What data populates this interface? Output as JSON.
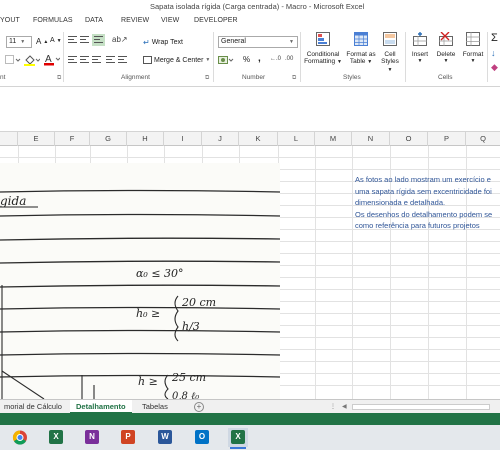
{
  "window": {
    "title": "Sapata isolada rígida (Carga centrada) - Macro - Microsoft Excel"
  },
  "ribbon_tabs": [
    "YOUT",
    "FORMULAS",
    "DATA",
    "REVIEW",
    "VIEW",
    "DEVELOPER"
  ],
  "ribbon": {
    "font_size": "11",
    "wrap_text": "Wrap Text",
    "merge_center": "Merge & Center",
    "number_format": "General",
    "percent": "%",
    "comma": ",",
    "conditional_formatting": [
      "Conditional",
      "Formatting"
    ],
    "format_as_table": [
      "Format as",
      "Table"
    ],
    "cell_styles": [
      "Cell",
      "Styles"
    ],
    "insert": "Insert",
    "delete": "Delete",
    "format": "Format",
    "groups": {
      "font_tail": "nt",
      "alignment": "Alignment",
      "number": "Number",
      "styles": "Styles",
      "cells": "Cells"
    }
  },
  "columns": [
    "E",
    "F",
    "G",
    "H",
    "I",
    "J",
    "K",
    "L",
    "M",
    "N",
    "O",
    "P",
    "Q"
  ],
  "notes": {
    "color": "#2f5597",
    "lines": [
      "As fotos ao lado mostram um exercício e",
      "uma sapata rígida sem excentricidade foi",
      "dimensionada e detalhada.",
      "Os desenhos do detalhamento podem se",
      "como referência para futuros projetos"
    ]
  },
  "photo_text": {
    "title": "gida",
    "alpha": "α₀ ≤ 30°",
    "h0_lhs": "h₀ ≥",
    "h0_a": "20 cm",
    "h0_b": "h/3",
    "h_lhs": "h ≥",
    "h_a": "25 cm",
    "h_b": "0,8 ℓ₀"
  },
  "sheets": [
    "morial de Cálculo",
    "Detalhamento",
    "Tabelas"
  ],
  "active_sheet": "Detalhamento",
  "taskbar_apps": [
    "chrome-icon",
    "excel-icon",
    "onenote-icon",
    "powerpoint-icon",
    "word-icon",
    "outlook-icon",
    "excel-active-icon"
  ],
  "accent": "#217346"
}
